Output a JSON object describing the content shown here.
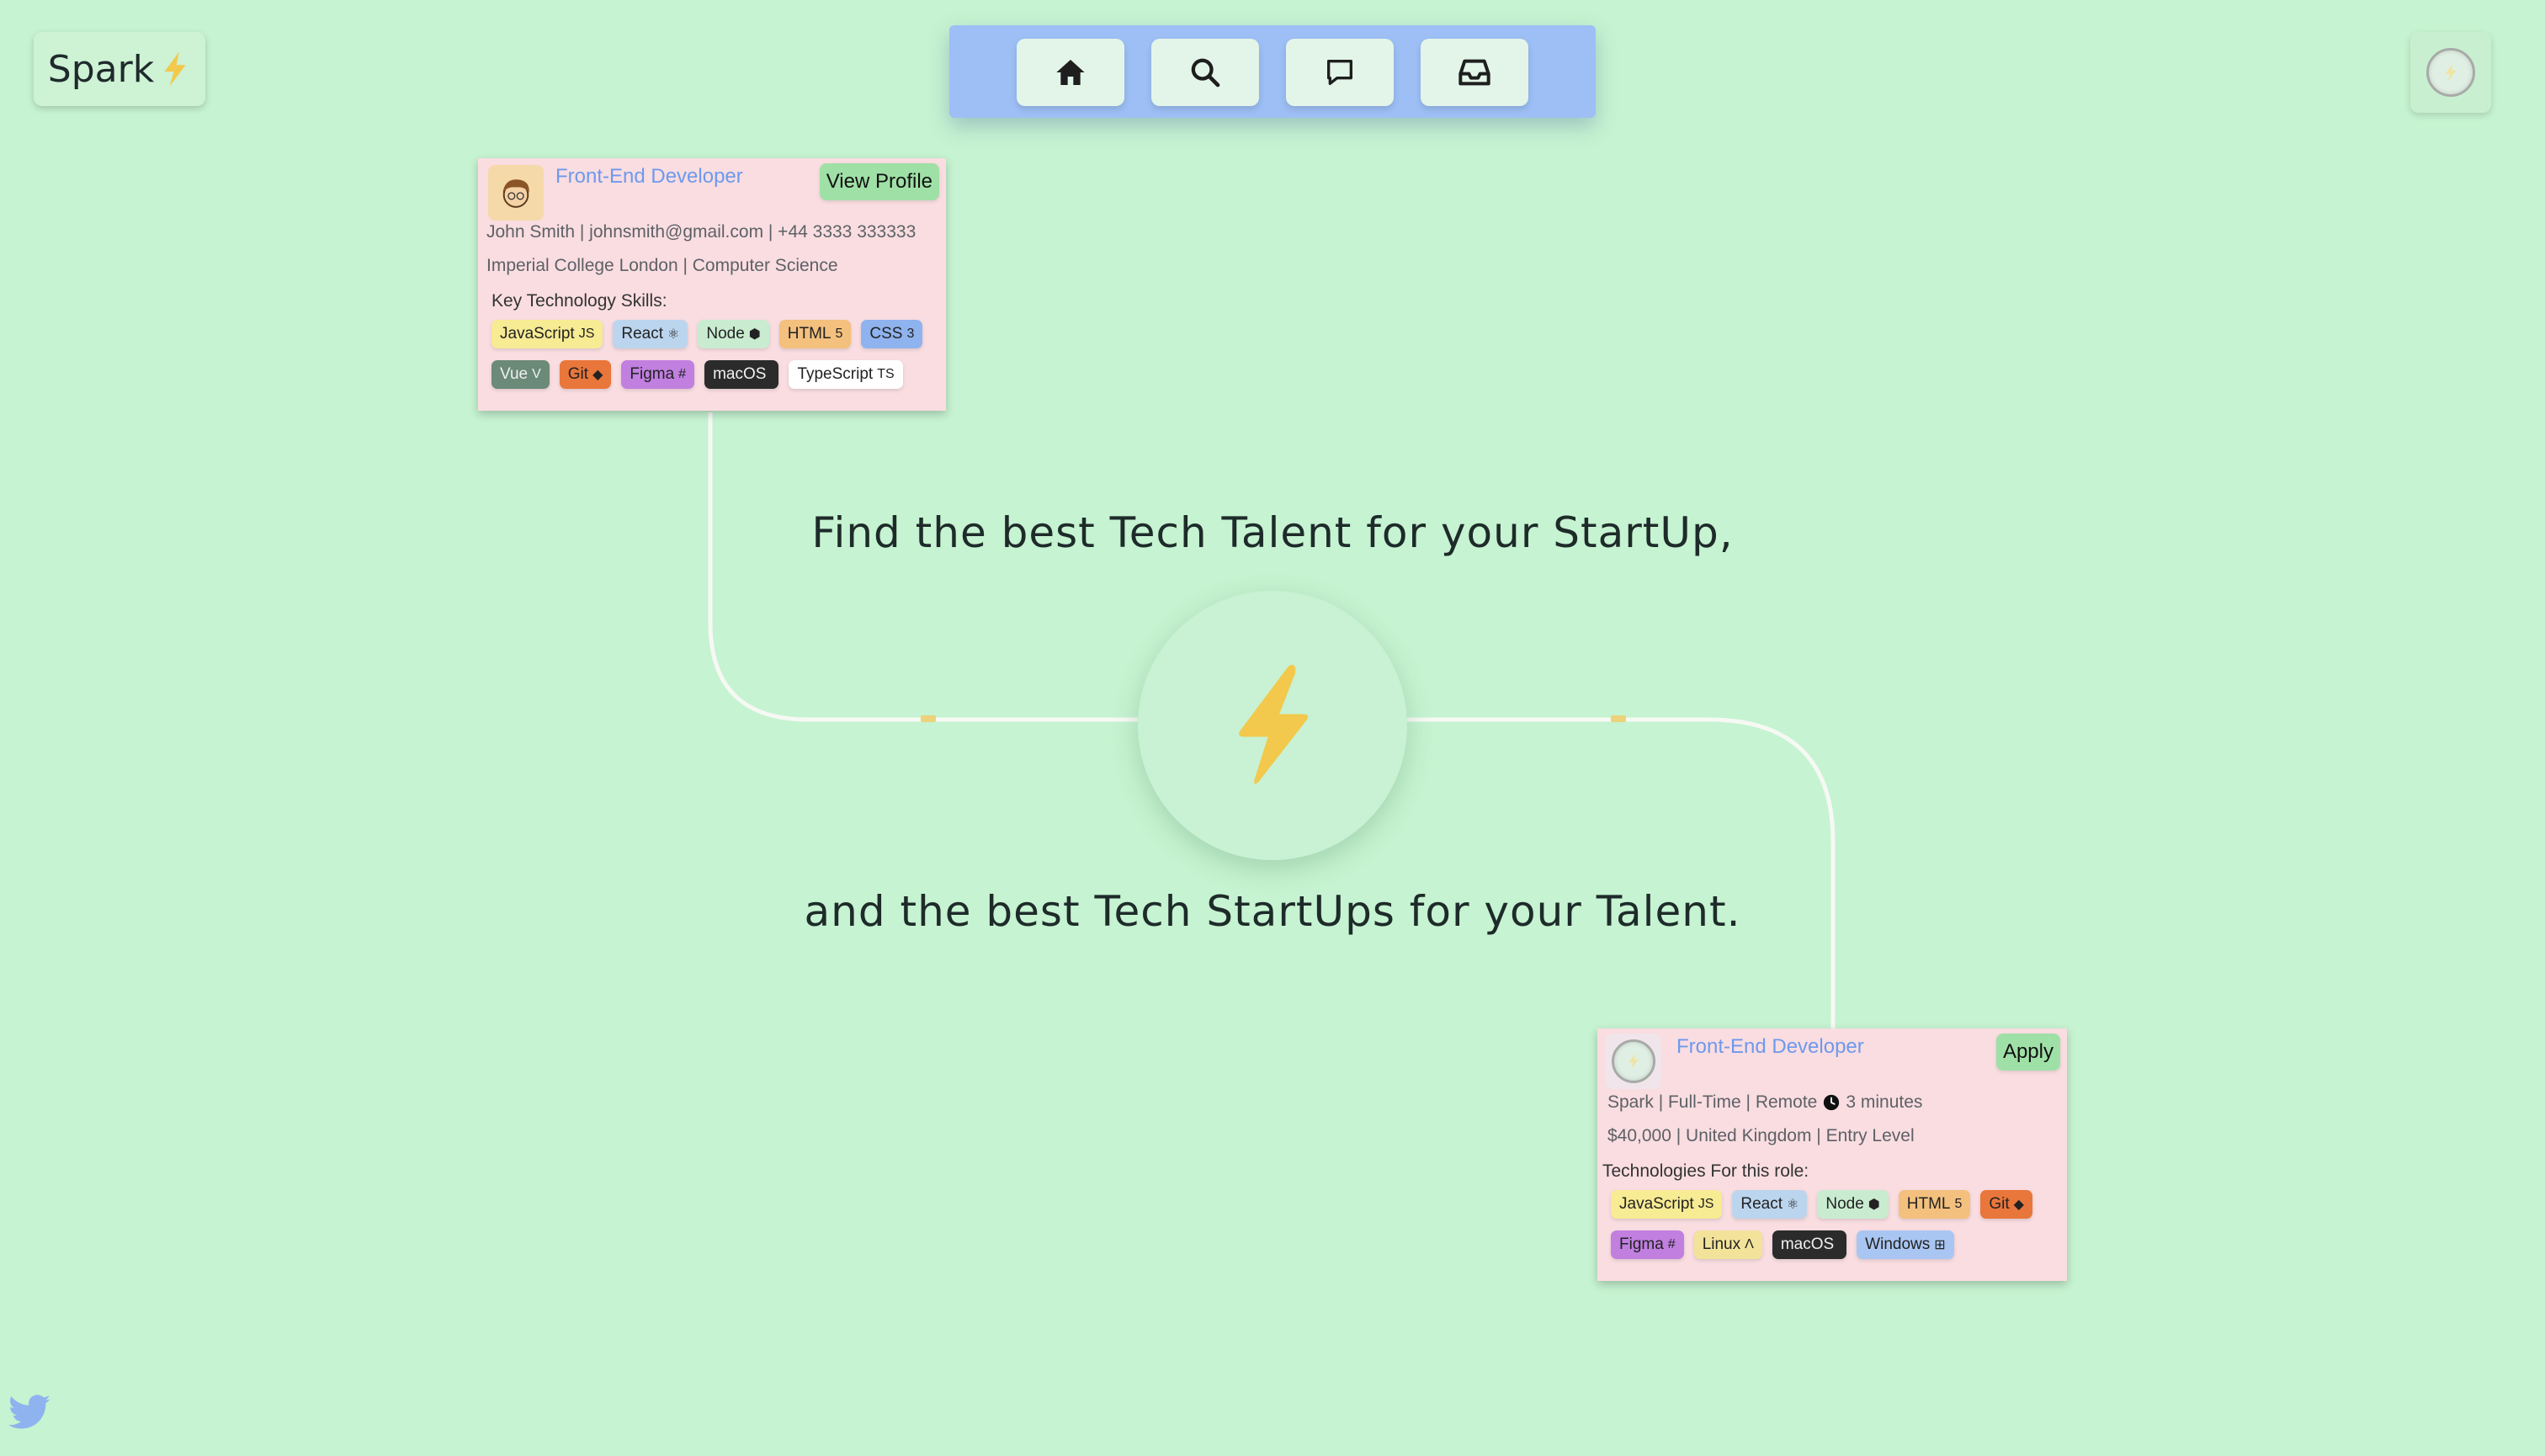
{
  "brand": {
    "name": "Spark"
  },
  "nav": {
    "items": [
      {
        "name": "home",
        "icon": "home-icon"
      },
      {
        "name": "search",
        "icon": "search-icon"
      },
      {
        "name": "messages",
        "icon": "chat-icon"
      },
      {
        "name": "inbox",
        "icon": "inbox-icon"
      }
    ]
  },
  "hero": {
    "line1": "Find the best Tech Talent for your StartUp,",
    "line2": "and the best Tech StartUps for your Talent."
  },
  "profile_card": {
    "title": "Front-End Developer",
    "action": "View Profile",
    "line1": "John Smith | johnsmith@gmail.com | +44 3333 333333",
    "line2": "Imperial College London | Computer Science",
    "skills_label": "Key Technology Skills:",
    "skills": [
      {
        "label": "JavaScript",
        "icon": "JS",
        "bg": "#f7eb93"
      },
      {
        "label": "React",
        "icon": "⚛",
        "bg": "#bcd5ee"
      },
      {
        "label": "Node",
        "icon": "⬢",
        "bg": "#c9ecd1"
      },
      {
        "label": "HTML",
        "icon": "5",
        "bg": "#f3c07e"
      },
      {
        "label": "CSS",
        "icon": "3",
        "bg": "#8fb3ee"
      },
      {
        "label": "Vue",
        "icon": "V",
        "bg": "#6b8a77"
      },
      {
        "label": "Git",
        "icon": "◆",
        "bg": "#e9763a"
      },
      {
        "label": "Figma",
        "icon": "#",
        "bg": "#c17fe0"
      },
      {
        "label": "macOS",
        "icon": "",
        "bg": "#2b2b2b"
      },
      {
        "label": "TypeScript",
        "icon": "TS",
        "bg": "#ffffff"
      }
    ]
  },
  "job_card": {
    "title": "Front-End Developer",
    "action": "Apply",
    "line1": "Spark | Full-Time | Remote",
    "time": "3 minutes",
    "line2": "$40,000 | United Kingdom | Entry Level",
    "tech_label": "Technologies For this role:",
    "tech": [
      {
        "label": "JavaScript",
        "icon": "JS",
        "bg": "#f7eb93"
      },
      {
        "label": "React",
        "icon": "⚛",
        "bg": "#bcd5ee"
      },
      {
        "label": "Node",
        "icon": "⬢",
        "bg": "#c9ecd1"
      },
      {
        "label": "HTML",
        "icon": "5",
        "bg": "#f3c07e"
      },
      {
        "label": "Git",
        "icon": "◆",
        "bg": "#e9763a"
      },
      {
        "label": "Figma",
        "icon": "#",
        "bg": "#c17fe0"
      },
      {
        "label": "Linux",
        "icon": "Λ",
        "bg": "#f3e39a"
      },
      {
        "label": "macOS",
        "icon": "",
        "bg": "#2b2b2b"
      },
      {
        "label": "Windows",
        "icon": "⊞",
        "bg": "#a9c6f2"
      }
    ]
  },
  "colors": {
    "background": "#c6f3d1",
    "nav": "#9dbff5",
    "card": "#f9dde1",
    "accent_title": "#6e99ec",
    "bolt": "#f2c94c",
    "action_button": "#9fe0a6"
  }
}
